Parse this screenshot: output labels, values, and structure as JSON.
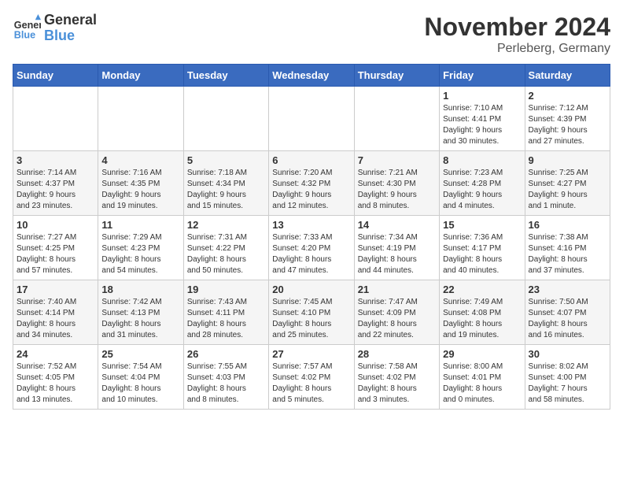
{
  "header": {
    "logo_line1": "General",
    "logo_line2": "Blue",
    "title": "November 2024",
    "subtitle": "Perleberg, Germany"
  },
  "weekdays": [
    "Sunday",
    "Monday",
    "Tuesday",
    "Wednesday",
    "Thursday",
    "Friday",
    "Saturday"
  ],
  "weeks": [
    [
      {
        "day": "",
        "info": ""
      },
      {
        "day": "",
        "info": ""
      },
      {
        "day": "",
        "info": ""
      },
      {
        "day": "",
        "info": ""
      },
      {
        "day": "",
        "info": ""
      },
      {
        "day": "1",
        "info": "Sunrise: 7:10 AM\nSunset: 4:41 PM\nDaylight: 9 hours\nand 30 minutes."
      },
      {
        "day": "2",
        "info": "Sunrise: 7:12 AM\nSunset: 4:39 PM\nDaylight: 9 hours\nand 27 minutes."
      }
    ],
    [
      {
        "day": "3",
        "info": "Sunrise: 7:14 AM\nSunset: 4:37 PM\nDaylight: 9 hours\nand 23 minutes."
      },
      {
        "day": "4",
        "info": "Sunrise: 7:16 AM\nSunset: 4:35 PM\nDaylight: 9 hours\nand 19 minutes."
      },
      {
        "day": "5",
        "info": "Sunrise: 7:18 AM\nSunset: 4:34 PM\nDaylight: 9 hours\nand 15 minutes."
      },
      {
        "day": "6",
        "info": "Sunrise: 7:20 AM\nSunset: 4:32 PM\nDaylight: 9 hours\nand 12 minutes."
      },
      {
        "day": "7",
        "info": "Sunrise: 7:21 AM\nSunset: 4:30 PM\nDaylight: 9 hours\nand 8 minutes."
      },
      {
        "day": "8",
        "info": "Sunrise: 7:23 AM\nSunset: 4:28 PM\nDaylight: 9 hours\nand 4 minutes."
      },
      {
        "day": "9",
        "info": "Sunrise: 7:25 AM\nSunset: 4:27 PM\nDaylight: 9 hours\nand 1 minute."
      }
    ],
    [
      {
        "day": "10",
        "info": "Sunrise: 7:27 AM\nSunset: 4:25 PM\nDaylight: 8 hours\nand 57 minutes."
      },
      {
        "day": "11",
        "info": "Sunrise: 7:29 AM\nSunset: 4:23 PM\nDaylight: 8 hours\nand 54 minutes."
      },
      {
        "day": "12",
        "info": "Sunrise: 7:31 AM\nSunset: 4:22 PM\nDaylight: 8 hours\nand 50 minutes."
      },
      {
        "day": "13",
        "info": "Sunrise: 7:33 AM\nSunset: 4:20 PM\nDaylight: 8 hours\nand 47 minutes."
      },
      {
        "day": "14",
        "info": "Sunrise: 7:34 AM\nSunset: 4:19 PM\nDaylight: 8 hours\nand 44 minutes."
      },
      {
        "day": "15",
        "info": "Sunrise: 7:36 AM\nSunset: 4:17 PM\nDaylight: 8 hours\nand 40 minutes."
      },
      {
        "day": "16",
        "info": "Sunrise: 7:38 AM\nSunset: 4:16 PM\nDaylight: 8 hours\nand 37 minutes."
      }
    ],
    [
      {
        "day": "17",
        "info": "Sunrise: 7:40 AM\nSunset: 4:14 PM\nDaylight: 8 hours\nand 34 minutes."
      },
      {
        "day": "18",
        "info": "Sunrise: 7:42 AM\nSunset: 4:13 PM\nDaylight: 8 hours\nand 31 minutes."
      },
      {
        "day": "19",
        "info": "Sunrise: 7:43 AM\nSunset: 4:11 PM\nDaylight: 8 hours\nand 28 minutes."
      },
      {
        "day": "20",
        "info": "Sunrise: 7:45 AM\nSunset: 4:10 PM\nDaylight: 8 hours\nand 25 minutes."
      },
      {
        "day": "21",
        "info": "Sunrise: 7:47 AM\nSunset: 4:09 PM\nDaylight: 8 hours\nand 22 minutes."
      },
      {
        "day": "22",
        "info": "Sunrise: 7:49 AM\nSunset: 4:08 PM\nDaylight: 8 hours\nand 19 minutes."
      },
      {
        "day": "23",
        "info": "Sunrise: 7:50 AM\nSunset: 4:07 PM\nDaylight: 8 hours\nand 16 minutes."
      }
    ],
    [
      {
        "day": "24",
        "info": "Sunrise: 7:52 AM\nSunset: 4:05 PM\nDaylight: 8 hours\nand 13 minutes."
      },
      {
        "day": "25",
        "info": "Sunrise: 7:54 AM\nSunset: 4:04 PM\nDaylight: 8 hours\nand 10 minutes."
      },
      {
        "day": "26",
        "info": "Sunrise: 7:55 AM\nSunset: 4:03 PM\nDaylight: 8 hours\nand 8 minutes."
      },
      {
        "day": "27",
        "info": "Sunrise: 7:57 AM\nSunset: 4:02 PM\nDaylight: 8 hours\nand 5 minutes."
      },
      {
        "day": "28",
        "info": "Sunrise: 7:58 AM\nSunset: 4:02 PM\nDaylight: 8 hours\nand 3 minutes."
      },
      {
        "day": "29",
        "info": "Sunrise: 8:00 AM\nSunset: 4:01 PM\nDaylight: 8 hours\nand 0 minutes."
      },
      {
        "day": "30",
        "info": "Sunrise: 8:02 AM\nSunset: 4:00 PM\nDaylight: 7 hours\nand 58 minutes."
      }
    ]
  ]
}
